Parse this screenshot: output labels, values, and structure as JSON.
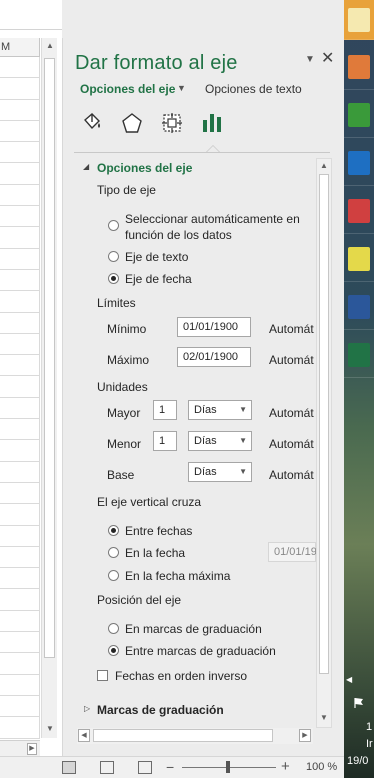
{
  "sheet": {
    "column_header": "M"
  },
  "pane": {
    "title": "Dar formato al eje",
    "tabs": {
      "active": "Opciones del eje",
      "other": "Opciones de texto"
    },
    "icon_tabs": [
      {
        "name": "fill-line-icon"
      },
      {
        "name": "effects-pentagon-icon"
      },
      {
        "name": "size-properties-icon"
      },
      {
        "name": "axis-options-bar-chart-icon"
      }
    ],
    "section_axis_options": "Opciones del eje",
    "axis_type": {
      "label": "Tipo de eje",
      "options": [
        {
          "line1": "Seleccionar automáticamente en",
          "line2": "función de los datos",
          "selected": false
        },
        {
          "label": "Eje de texto",
          "selected": false
        },
        {
          "label": "Eje de fecha",
          "selected": true
        }
      ]
    },
    "limits": {
      "label": "Límites",
      "min_label": "Mínimo",
      "min_value": "01/01/1900",
      "min_auto": "Automát",
      "max_label": "Máximo",
      "max_value": "02/01/1900",
      "max_auto": "Automát"
    },
    "units": {
      "label": "Unidades",
      "major_label": "Mayor",
      "major_value": "1",
      "major_unit": "Días",
      "major_auto": "Automát",
      "minor_label": "Menor",
      "minor_value": "1",
      "minor_unit": "Días",
      "minor_auto": "Automát",
      "base_label": "Base",
      "base_unit": "Días",
      "base_auto": "Automát"
    },
    "vertical_axis_crosses": {
      "label": "El eje vertical cruza",
      "options": [
        {
          "label": "Entre fechas",
          "selected": true
        },
        {
          "label": "En la fecha",
          "selected": false
        },
        {
          "label": "En la fecha máxima",
          "selected": false
        }
      ],
      "date_value": "01/01/19"
    },
    "axis_position": {
      "label": "Posición del eje",
      "options": [
        {
          "label": "En marcas de graduación",
          "selected": false
        },
        {
          "label": "Entre marcas de graduación",
          "selected": true
        }
      ]
    },
    "reverse_dates": {
      "label": "Fechas en orden inverso",
      "checked": false
    },
    "section_tick_marks": "Marcas de graduación"
  },
  "status": {
    "zoom": "100 %"
  },
  "taskbar": {
    "time_1": "1",
    "time_2": "Ir",
    "date": "19/0"
  },
  "colors": {
    "excel_green": "#217346",
    "pane_bg": "#ececec"
  }
}
